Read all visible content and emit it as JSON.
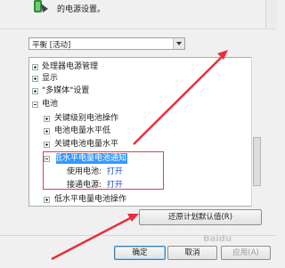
{
  "header": {
    "description": "的电源设置。"
  },
  "plan_select": {
    "value": "平衡 [活动]"
  },
  "tree": {
    "items": [
      {
        "label": "处理器电源管理",
        "expander": "plus"
      },
      {
        "label": "显示",
        "expander": "plus"
      },
      {
        "label": "\"多媒体\"设置",
        "expander": "plus"
      },
      {
        "label": "电池",
        "expander": "minus"
      },
      {
        "label": "关键级别电池操作",
        "expander": "plus"
      },
      {
        "label": "电池电量水平低",
        "expander": "plus"
      },
      {
        "label": "关键电池电量水平",
        "expander": "plus"
      },
      {
        "label": "低水平电量电池通知",
        "expander": "minus",
        "selected": true
      },
      {
        "label": "使用电池:",
        "value": "打开"
      },
      {
        "label": "接通电源:",
        "value": "打开"
      },
      {
        "label": "低水平电量电池操作",
        "expander": "plus"
      }
    ]
  },
  "buttons": {
    "restore": "还原计划默认值(R)",
    "ok": "确定",
    "cancel": "取消",
    "apply": "应用(A)"
  },
  "watermark": "Baidu",
  "colors": {
    "highlight_border": "#e0404a",
    "arrow": "#e8303a",
    "link": "#1a4fd6",
    "selection": "#3399ff"
  }
}
